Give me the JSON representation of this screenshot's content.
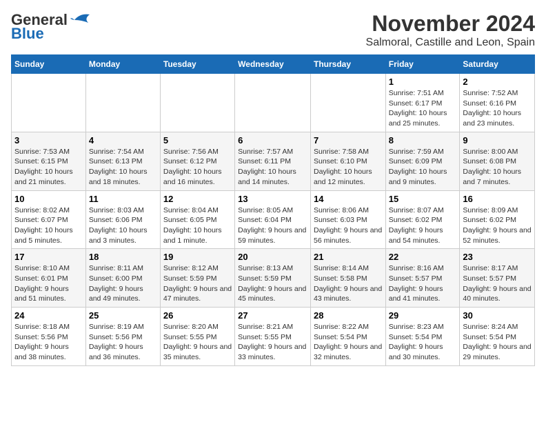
{
  "logo": {
    "line1": "General",
    "line2": "Blue"
  },
  "title": "November 2024",
  "location": "Salmoral, Castille and Leon, Spain",
  "weekdays": [
    "Sunday",
    "Monday",
    "Tuesday",
    "Wednesday",
    "Thursday",
    "Friday",
    "Saturday"
  ],
  "weeks": [
    [
      {
        "day": "",
        "info": ""
      },
      {
        "day": "",
        "info": ""
      },
      {
        "day": "",
        "info": ""
      },
      {
        "day": "",
        "info": ""
      },
      {
        "day": "",
        "info": ""
      },
      {
        "day": "1",
        "info": "Sunrise: 7:51 AM\nSunset: 6:17 PM\nDaylight: 10 hours and 25 minutes."
      },
      {
        "day": "2",
        "info": "Sunrise: 7:52 AM\nSunset: 6:16 PM\nDaylight: 10 hours and 23 minutes."
      }
    ],
    [
      {
        "day": "3",
        "info": "Sunrise: 7:53 AM\nSunset: 6:15 PM\nDaylight: 10 hours and 21 minutes."
      },
      {
        "day": "4",
        "info": "Sunrise: 7:54 AM\nSunset: 6:13 PM\nDaylight: 10 hours and 18 minutes."
      },
      {
        "day": "5",
        "info": "Sunrise: 7:56 AM\nSunset: 6:12 PM\nDaylight: 10 hours and 16 minutes."
      },
      {
        "day": "6",
        "info": "Sunrise: 7:57 AM\nSunset: 6:11 PM\nDaylight: 10 hours and 14 minutes."
      },
      {
        "day": "7",
        "info": "Sunrise: 7:58 AM\nSunset: 6:10 PM\nDaylight: 10 hours and 12 minutes."
      },
      {
        "day": "8",
        "info": "Sunrise: 7:59 AM\nSunset: 6:09 PM\nDaylight: 10 hours and 9 minutes."
      },
      {
        "day": "9",
        "info": "Sunrise: 8:00 AM\nSunset: 6:08 PM\nDaylight: 10 hours and 7 minutes."
      }
    ],
    [
      {
        "day": "10",
        "info": "Sunrise: 8:02 AM\nSunset: 6:07 PM\nDaylight: 10 hours and 5 minutes."
      },
      {
        "day": "11",
        "info": "Sunrise: 8:03 AM\nSunset: 6:06 PM\nDaylight: 10 hours and 3 minutes."
      },
      {
        "day": "12",
        "info": "Sunrise: 8:04 AM\nSunset: 6:05 PM\nDaylight: 10 hours and 1 minute."
      },
      {
        "day": "13",
        "info": "Sunrise: 8:05 AM\nSunset: 6:04 PM\nDaylight: 9 hours and 59 minutes."
      },
      {
        "day": "14",
        "info": "Sunrise: 8:06 AM\nSunset: 6:03 PM\nDaylight: 9 hours and 56 minutes."
      },
      {
        "day": "15",
        "info": "Sunrise: 8:07 AM\nSunset: 6:02 PM\nDaylight: 9 hours and 54 minutes."
      },
      {
        "day": "16",
        "info": "Sunrise: 8:09 AM\nSunset: 6:02 PM\nDaylight: 9 hours and 52 minutes."
      }
    ],
    [
      {
        "day": "17",
        "info": "Sunrise: 8:10 AM\nSunset: 6:01 PM\nDaylight: 9 hours and 51 minutes."
      },
      {
        "day": "18",
        "info": "Sunrise: 8:11 AM\nSunset: 6:00 PM\nDaylight: 9 hours and 49 minutes."
      },
      {
        "day": "19",
        "info": "Sunrise: 8:12 AM\nSunset: 5:59 PM\nDaylight: 9 hours and 47 minutes."
      },
      {
        "day": "20",
        "info": "Sunrise: 8:13 AM\nSunset: 5:59 PM\nDaylight: 9 hours and 45 minutes."
      },
      {
        "day": "21",
        "info": "Sunrise: 8:14 AM\nSunset: 5:58 PM\nDaylight: 9 hours and 43 minutes."
      },
      {
        "day": "22",
        "info": "Sunrise: 8:16 AM\nSunset: 5:57 PM\nDaylight: 9 hours and 41 minutes."
      },
      {
        "day": "23",
        "info": "Sunrise: 8:17 AM\nSunset: 5:57 PM\nDaylight: 9 hours and 40 minutes."
      }
    ],
    [
      {
        "day": "24",
        "info": "Sunrise: 8:18 AM\nSunset: 5:56 PM\nDaylight: 9 hours and 38 minutes."
      },
      {
        "day": "25",
        "info": "Sunrise: 8:19 AM\nSunset: 5:56 PM\nDaylight: 9 hours and 36 minutes."
      },
      {
        "day": "26",
        "info": "Sunrise: 8:20 AM\nSunset: 5:55 PM\nDaylight: 9 hours and 35 minutes."
      },
      {
        "day": "27",
        "info": "Sunrise: 8:21 AM\nSunset: 5:55 PM\nDaylight: 9 hours and 33 minutes."
      },
      {
        "day": "28",
        "info": "Sunrise: 8:22 AM\nSunset: 5:54 PM\nDaylight: 9 hours and 32 minutes."
      },
      {
        "day": "29",
        "info": "Sunrise: 8:23 AM\nSunset: 5:54 PM\nDaylight: 9 hours and 30 minutes."
      },
      {
        "day": "30",
        "info": "Sunrise: 8:24 AM\nSunset: 5:54 PM\nDaylight: 9 hours and 29 minutes."
      }
    ]
  ]
}
